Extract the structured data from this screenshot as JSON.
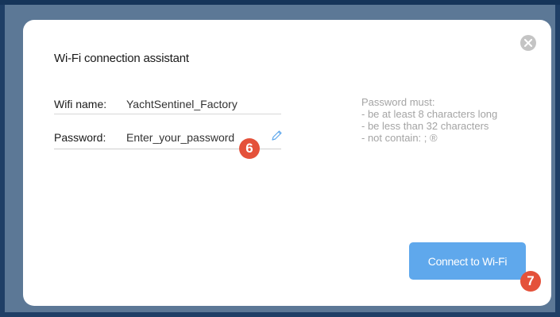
{
  "dialog": {
    "title": "Wi-Fi connection assistant",
    "close_icon": "close-icon",
    "wifi_name": {
      "label": "Wifi name:",
      "value": "YachtSentinel_Factory"
    },
    "password": {
      "label": "Password:",
      "value": "Enter_your_password",
      "edit_icon": "pencil-icon"
    },
    "hint": {
      "heading": "Password must:",
      "rules": [
        "- be at least 8 characters long",
        "- be less than 32 characters",
        "- not contain: ; ®"
      ]
    },
    "connect_label": "Connect to Wi-Fi"
  },
  "callouts": [
    "6",
    "7"
  ],
  "colors": {
    "accent": "#5fa8ec",
    "callout": "#e4513a",
    "backdrop": "#5c7896"
  }
}
